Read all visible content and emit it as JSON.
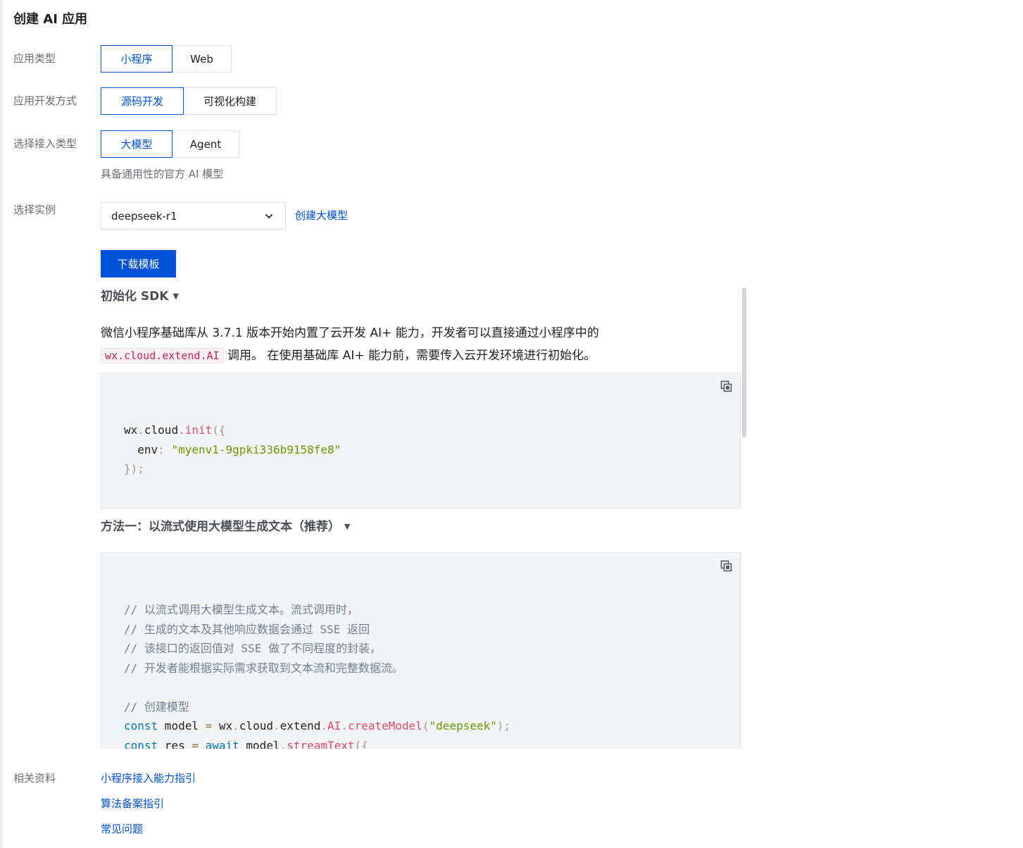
{
  "page": {
    "title": "创建 AI 应用"
  },
  "form": {
    "app_type": {
      "label": "应用类型",
      "options": [
        "小程序",
        "Web"
      ],
      "selected": "小程序"
    },
    "dev_mode": {
      "label": "应用开发方式",
      "options": [
        "源码开发",
        "可视化构建"
      ],
      "selected": "源码开发"
    },
    "access_type": {
      "label": "选择接入类型",
      "options": [
        "大模型",
        "Agent"
      ],
      "selected": "大模型",
      "hint": "具备通用性的官方 AI 模型"
    },
    "instance": {
      "label": "选择实例",
      "value": "deepseek-r1",
      "create_link": "创建大模型"
    }
  },
  "download_button": "下载模板",
  "sections": {
    "init": {
      "title": "初始化 SDK",
      "para_before": "微信小程序基础库从 3.7.1 版本开始内置了云开发 AI+ 能力，开发者可以直接通过小程序中的",
      "inline_code": "wx.cloud.extend.AI",
      "para_after": " 调用。 在使用基础库 AI+ 能力前，需要传入云开发环境进行初始化。",
      "code": {
        "l1": {
          "a": "wx",
          "b": ".",
          "c": "cloud",
          "d": ".",
          "e": "init",
          "f": "({"
        },
        "l2": {
          "a": "  env",
          "b": ":",
          "c": " ",
          "d": "\"myenv1-9gpki336b9158fe8\""
        },
        "l3": {
          "a": "});"
        }
      }
    },
    "stream": {
      "title": "方法一：以流式使用大模型生成文本（推荐）",
      "code": {
        "comments": [
          "// 以流式调用大模型生成文本。流式调用时，",
          "// 生成的文本及其他响应数据会通过 SSE 返回",
          "// 该接口的返回值对 SSE 做了不同程度的封装，",
          "// 开发者能根据实际需求获取到文本流和完整数据流。"
        ],
        "comment_create": "// 创建模型",
        "l_model": {
          "kw": "const",
          "name": " model ",
          "op": "=",
          "a": " wx",
          "p1": ".",
          "b": "cloud",
          "p2": ".",
          "c": "extend",
          "p3": ".",
          "d": "AI",
          "p4": ".",
          "fn": "createModel",
          "p5": "(",
          "s": "\"deepseek\"",
          "p6": ");"
        },
        "l_res": {
          "kw": "const",
          "name": " res ",
          "op": "=",
          "kw2": " await",
          "a": " model",
          "p1": ".",
          "fn": "streamText",
          "p2": "({"
        }
      }
    }
  },
  "resources": {
    "label": "相关资料",
    "links": [
      "小程序接入能力指引",
      "算法备案指引",
      "常见问题"
    ]
  },
  "icons": {
    "select_caret": "chevron-down-icon",
    "copy": "copy-icon",
    "section_caret": "caret-down-icon"
  },
  "colors": {
    "primary": "#0052d9",
    "border": "#dcdfe3",
    "code_bg": "#f3f4f6",
    "muted": "#6b6e73"
  }
}
